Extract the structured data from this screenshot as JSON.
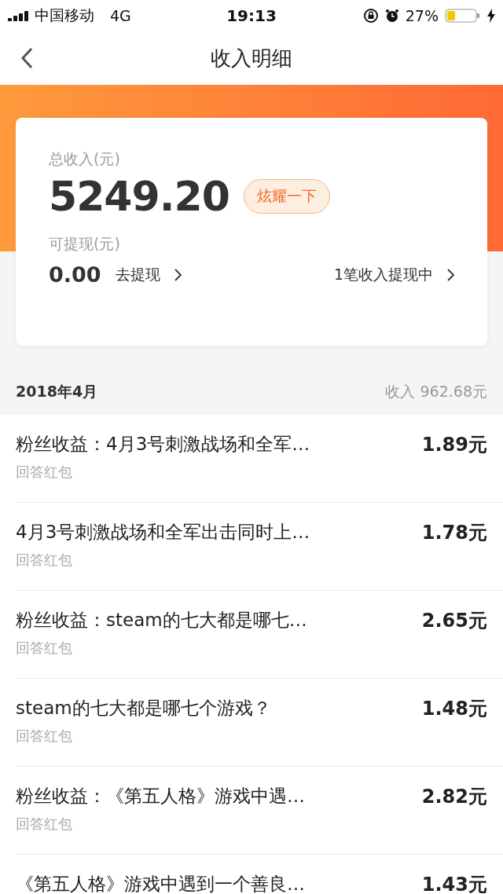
{
  "status_bar": {
    "carrier": "中国移动",
    "network": "4G",
    "time": "19:13",
    "battery": "27%"
  },
  "nav": {
    "title": "收入明细"
  },
  "summary": {
    "total_label": "总收入(元)",
    "total": "5249.20",
    "show_off_button": "炫耀一下",
    "withdrawable_label": "可提现(元)",
    "withdrawable": "0.00",
    "withdraw_link": "去提现",
    "pending_link": "1笔收入提现中"
  },
  "month": {
    "label": "2018年4月",
    "income": "收入 962.68元"
  },
  "records": [
    {
      "title": "粉丝收益：4月3号刺激战场和全军…",
      "subtitle": "回答红包",
      "amount": "1.89元"
    },
    {
      "title": "4月3号刺激战场和全军出击同时上…",
      "subtitle": "回答红包",
      "amount": "1.78元"
    },
    {
      "title": "粉丝收益：steam的七大都是哪七…",
      "subtitle": "回答红包",
      "amount": "2.65元"
    },
    {
      "title": "steam的七大都是哪七个游戏？",
      "subtitle": "回答红包",
      "amount": "1.48元"
    },
    {
      "title": "粉丝收益：《第五人格》游戏中遇…",
      "subtitle": "回答红包",
      "amount": "2.82元"
    },
    {
      "title": "《第五人格》游戏中遇到一个善良…",
      "amount": "1.43元"
    }
  ]
}
